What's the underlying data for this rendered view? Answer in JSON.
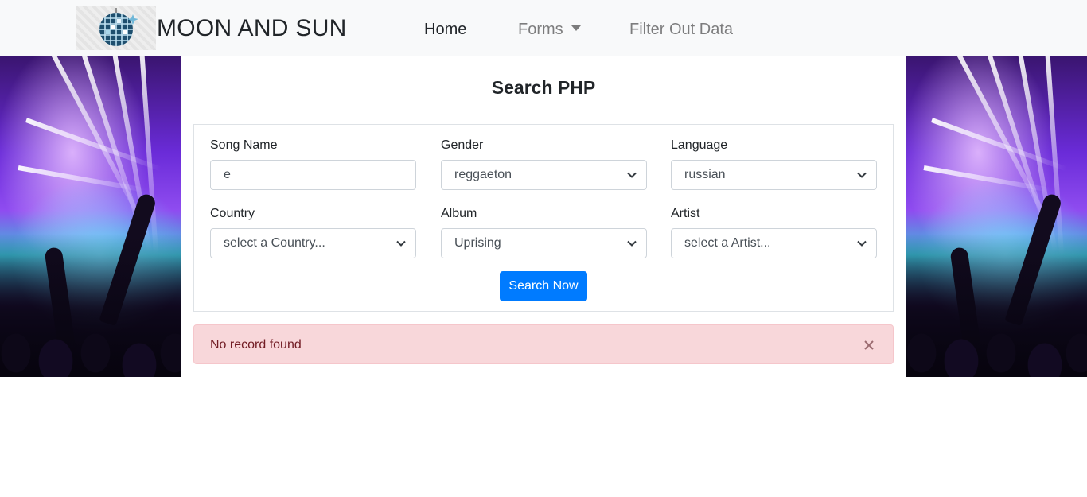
{
  "navbar": {
    "brand": "MOON AND SUN",
    "logo_icon": "disco-ball-icon",
    "links": {
      "home": "Home",
      "forms": "Forms",
      "filter": "Filter Out Data"
    }
  },
  "main": {
    "title": "Search PHP"
  },
  "form": {
    "song_name": {
      "label": "Song Name",
      "value": "e"
    },
    "gender": {
      "label": "Gender",
      "value": "reggaeton"
    },
    "language": {
      "label": "Language",
      "value": "russian"
    },
    "country": {
      "label": "Country",
      "value": "select a Country..."
    },
    "album": {
      "label": "Album",
      "value": "Uprising"
    },
    "artist": {
      "label": "Artist",
      "value": "select a Artist..."
    },
    "submit_label": "Search Now"
  },
  "alert": {
    "message": "No record found",
    "close_icon": "close-icon"
  },
  "colors": {
    "primary": "#007bff",
    "alert_bg": "#f8d7da",
    "alert_text": "#721c24",
    "navbar_bg": "#f8f9fa"
  }
}
